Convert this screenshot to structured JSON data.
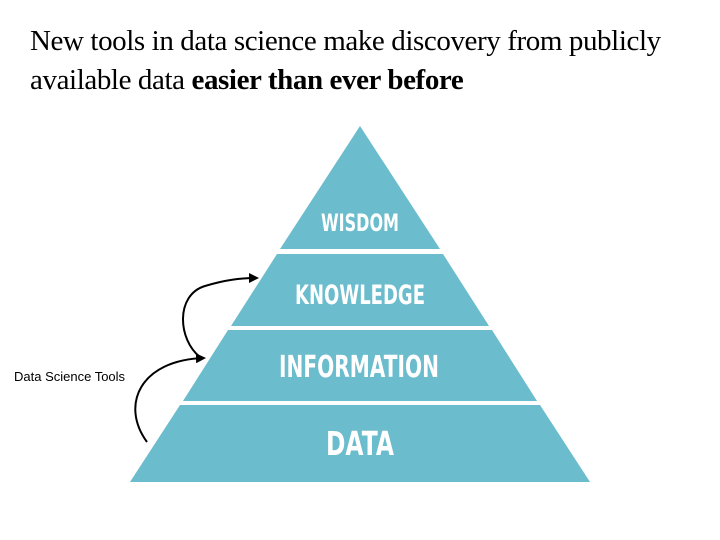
{
  "title": {
    "line1": "New tools in data science make discovery from publicly",
    "line2_regular": "available data ",
    "line2_bold": "easier than ever before"
  },
  "pyramid": {
    "tiers": [
      "WISDOM",
      "KNOWLEDGE",
      "INFORMATION",
      "DATA"
    ],
    "fill_color": "#6bbccc"
  },
  "side_label": "Data Science Tools"
}
